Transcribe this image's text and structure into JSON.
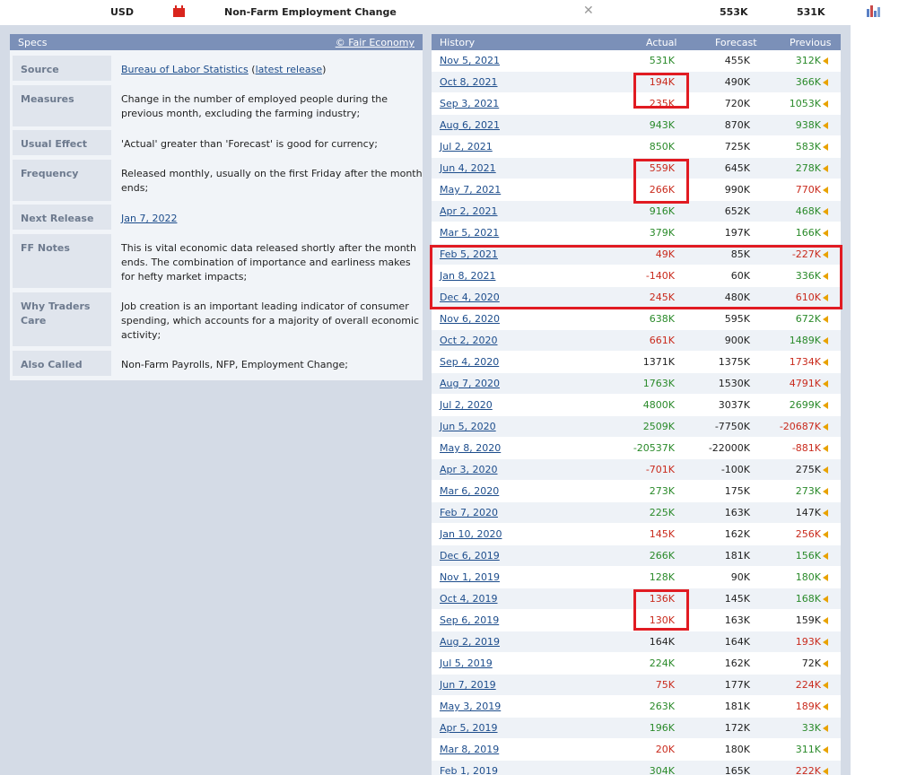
{
  "event": {
    "currency": "USD",
    "title": "Non-Farm Employment Change",
    "detail_icon": "close-detail-icon",
    "actual": "553K",
    "forecast": "531K",
    "graph_icon": "graph-icon",
    "impact": "high-impact-folder-icon",
    "impact_color": "#d9251d"
  },
  "specs": {
    "header": "Specs",
    "credit": "© Fair Economy",
    "rows": [
      {
        "label": "Source",
        "value_pre": "",
        "link1": "Bureau of Labor Statistics",
        "mid": " (",
        "link2": "latest release",
        "post": ")"
      },
      {
        "label": "Measures",
        "value": "Change in the number of employed people during the previous month, excluding the farming industry;"
      },
      {
        "label": "Usual Effect",
        "value": "'Actual' greater than 'Forecast' is good for currency;"
      },
      {
        "label": "Frequency",
        "value": "Released monthly, usually on the first Friday after the month ends;"
      },
      {
        "label": "Next Release",
        "link": "Jan 7, 2022"
      },
      {
        "label": "FF Notes",
        "value": "This is vital economic data released shortly after the month ends. The combination of importance and earliness makes for hefty market impacts;"
      },
      {
        "label": "Why Traders Care",
        "value": "Job creation is an important leading indicator of consumer spending, which accounts for a majority of overall economic activity;"
      },
      {
        "label": "Also Called",
        "value": "Non-Farm Payrolls, NFP, Employment Change;"
      }
    ]
  },
  "history": {
    "columns": {
      "history": "History",
      "actual": "Actual",
      "forecast": "Forecast",
      "previous": "Previous"
    },
    "colors": {
      "better": "#2a8a2a",
      "worse": "#c92a1c",
      "revision": "#e8a200",
      "annotation": "#e11b22"
    },
    "rows": [
      {
        "date": "Nov 5, 2021",
        "actual": "531K",
        "ac": "g",
        "forecast": "455K",
        "previous": "312K",
        "pc": "g",
        "rev": true
      },
      {
        "date": "Oct 8, 2021",
        "actual": "194K",
        "ac": "r",
        "forecast": "490K",
        "previous": "366K",
        "pc": "g",
        "rev": true
      },
      {
        "date": "Sep 3, 2021",
        "actual": "235K",
        "ac": "r",
        "forecast": "720K",
        "previous": "1053K",
        "pc": "g",
        "rev": true
      },
      {
        "date": "Aug 6, 2021",
        "actual": "943K",
        "ac": "g",
        "forecast": "870K",
        "previous": "938K",
        "pc": "g",
        "rev": true
      },
      {
        "date": "Jul 2, 2021",
        "actual": "850K",
        "ac": "g",
        "forecast": "725K",
        "previous": "583K",
        "pc": "g",
        "rev": true
      },
      {
        "date": "Jun 4, 2021",
        "actual": "559K",
        "ac": "r",
        "forecast": "645K",
        "previous": "278K",
        "pc": "g",
        "rev": true
      },
      {
        "date": "May 7, 2021",
        "actual": "266K",
        "ac": "r",
        "forecast": "990K",
        "previous": "770K",
        "pc": "r",
        "rev": true
      },
      {
        "date": "Apr 2, 2021",
        "actual": "916K",
        "ac": "g",
        "forecast": "652K",
        "previous": "468K",
        "pc": "g",
        "rev": true
      },
      {
        "date": "Mar 5, 2021",
        "actual": "379K",
        "ac": "g",
        "forecast": "197K",
        "previous": "166K",
        "pc": "g",
        "rev": true
      },
      {
        "date": "Feb 5, 2021",
        "actual": "49K",
        "ac": "r",
        "forecast": "85K",
        "previous": "-227K",
        "pc": "r",
        "rev": true
      },
      {
        "date": "Jan 8, 2021",
        "actual": "-140K",
        "ac": "r",
        "forecast": "60K",
        "previous": "336K",
        "pc": "g",
        "rev": true
      },
      {
        "date": "Dec 4, 2020",
        "actual": "245K",
        "ac": "r",
        "forecast": "480K",
        "previous": "610K",
        "pc": "r",
        "rev": true
      },
      {
        "date": "Nov 6, 2020",
        "actual": "638K",
        "ac": "g",
        "forecast": "595K",
        "previous": "672K",
        "pc": "g",
        "rev": true
      },
      {
        "date": "Oct 2, 2020",
        "actual": "661K",
        "ac": "r",
        "forecast": "900K",
        "previous": "1489K",
        "pc": "g",
        "rev": true
      },
      {
        "date": "Sep 4, 2020",
        "actual": "1371K",
        "ac": "n",
        "forecast": "1375K",
        "previous": "1734K",
        "pc": "r",
        "rev": true
      },
      {
        "date": "Aug 7, 2020",
        "actual": "1763K",
        "ac": "g",
        "forecast": "1530K",
        "previous": "4791K",
        "pc": "r",
        "rev": true
      },
      {
        "date": "Jul 2, 2020",
        "actual": "4800K",
        "ac": "g",
        "forecast": "3037K",
        "previous": "2699K",
        "pc": "g",
        "rev": true
      },
      {
        "date": "Jun 5, 2020",
        "actual": "2509K",
        "ac": "g",
        "forecast": "-7750K",
        "previous": "-20687K",
        "pc": "r",
        "rev": true
      },
      {
        "date": "May 8, 2020",
        "actual": "-20537K",
        "ac": "g",
        "forecast": "-22000K",
        "previous": "-881K",
        "pc": "r",
        "rev": true
      },
      {
        "date": "Apr 3, 2020",
        "actual": "-701K",
        "ac": "r",
        "forecast": "-100K",
        "previous": "275K",
        "pc": "n",
        "rev": true
      },
      {
        "date": "Mar 6, 2020",
        "actual": "273K",
        "ac": "g",
        "forecast": "175K",
        "previous": "273K",
        "pc": "g",
        "rev": true
      },
      {
        "date": "Feb 7, 2020",
        "actual": "225K",
        "ac": "g",
        "forecast": "163K",
        "previous": "147K",
        "pc": "n",
        "rev": true
      },
      {
        "date": "Jan 10, 2020",
        "actual": "145K",
        "ac": "r",
        "forecast": "162K",
        "previous": "256K",
        "pc": "r",
        "rev": true
      },
      {
        "date": "Dec 6, 2019",
        "actual": "266K",
        "ac": "g",
        "forecast": "181K",
        "previous": "156K",
        "pc": "g",
        "rev": true
      },
      {
        "date": "Nov 1, 2019",
        "actual": "128K",
        "ac": "g",
        "forecast": "90K",
        "previous": "180K",
        "pc": "g",
        "rev": true
      },
      {
        "date": "Oct 4, 2019",
        "actual": "136K",
        "ac": "r",
        "forecast": "145K",
        "previous": "168K",
        "pc": "g",
        "rev": true
      },
      {
        "date": "Sep 6, 2019",
        "actual": "130K",
        "ac": "r",
        "forecast": "163K",
        "previous": "159K",
        "pc": "n",
        "rev": true
      },
      {
        "date": "Aug 2, 2019",
        "actual": "164K",
        "ac": "n",
        "forecast": "164K",
        "previous": "193K",
        "pc": "r",
        "rev": true
      },
      {
        "date": "Jul 5, 2019",
        "actual": "224K",
        "ac": "g",
        "forecast": "162K",
        "previous": "72K",
        "pc": "n",
        "rev": true
      },
      {
        "date": "Jun 7, 2019",
        "actual": "75K",
        "ac": "r",
        "forecast": "177K",
        "previous": "224K",
        "pc": "r",
        "rev": true
      },
      {
        "date": "May 3, 2019",
        "actual": "263K",
        "ac": "g",
        "forecast": "181K",
        "previous": "189K",
        "pc": "r",
        "rev": true
      },
      {
        "date": "Apr 5, 2019",
        "actual": "196K",
        "ac": "g",
        "forecast": "172K",
        "previous": "33K",
        "pc": "g",
        "rev": true
      },
      {
        "date": "Mar 8, 2019",
        "actual": "20K",
        "ac": "r",
        "forecast": "180K",
        "previous": "311K",
        "pc": "g",
        "rev": true
      },
      {
        "date": "Feb 1, 2019",
        "actual": "304K",
        "ac": "g",
        "forecast": "165K",
        "previous": "222K",
        "pc": "r",
        "rev": true
      }
    ]
  }
}
